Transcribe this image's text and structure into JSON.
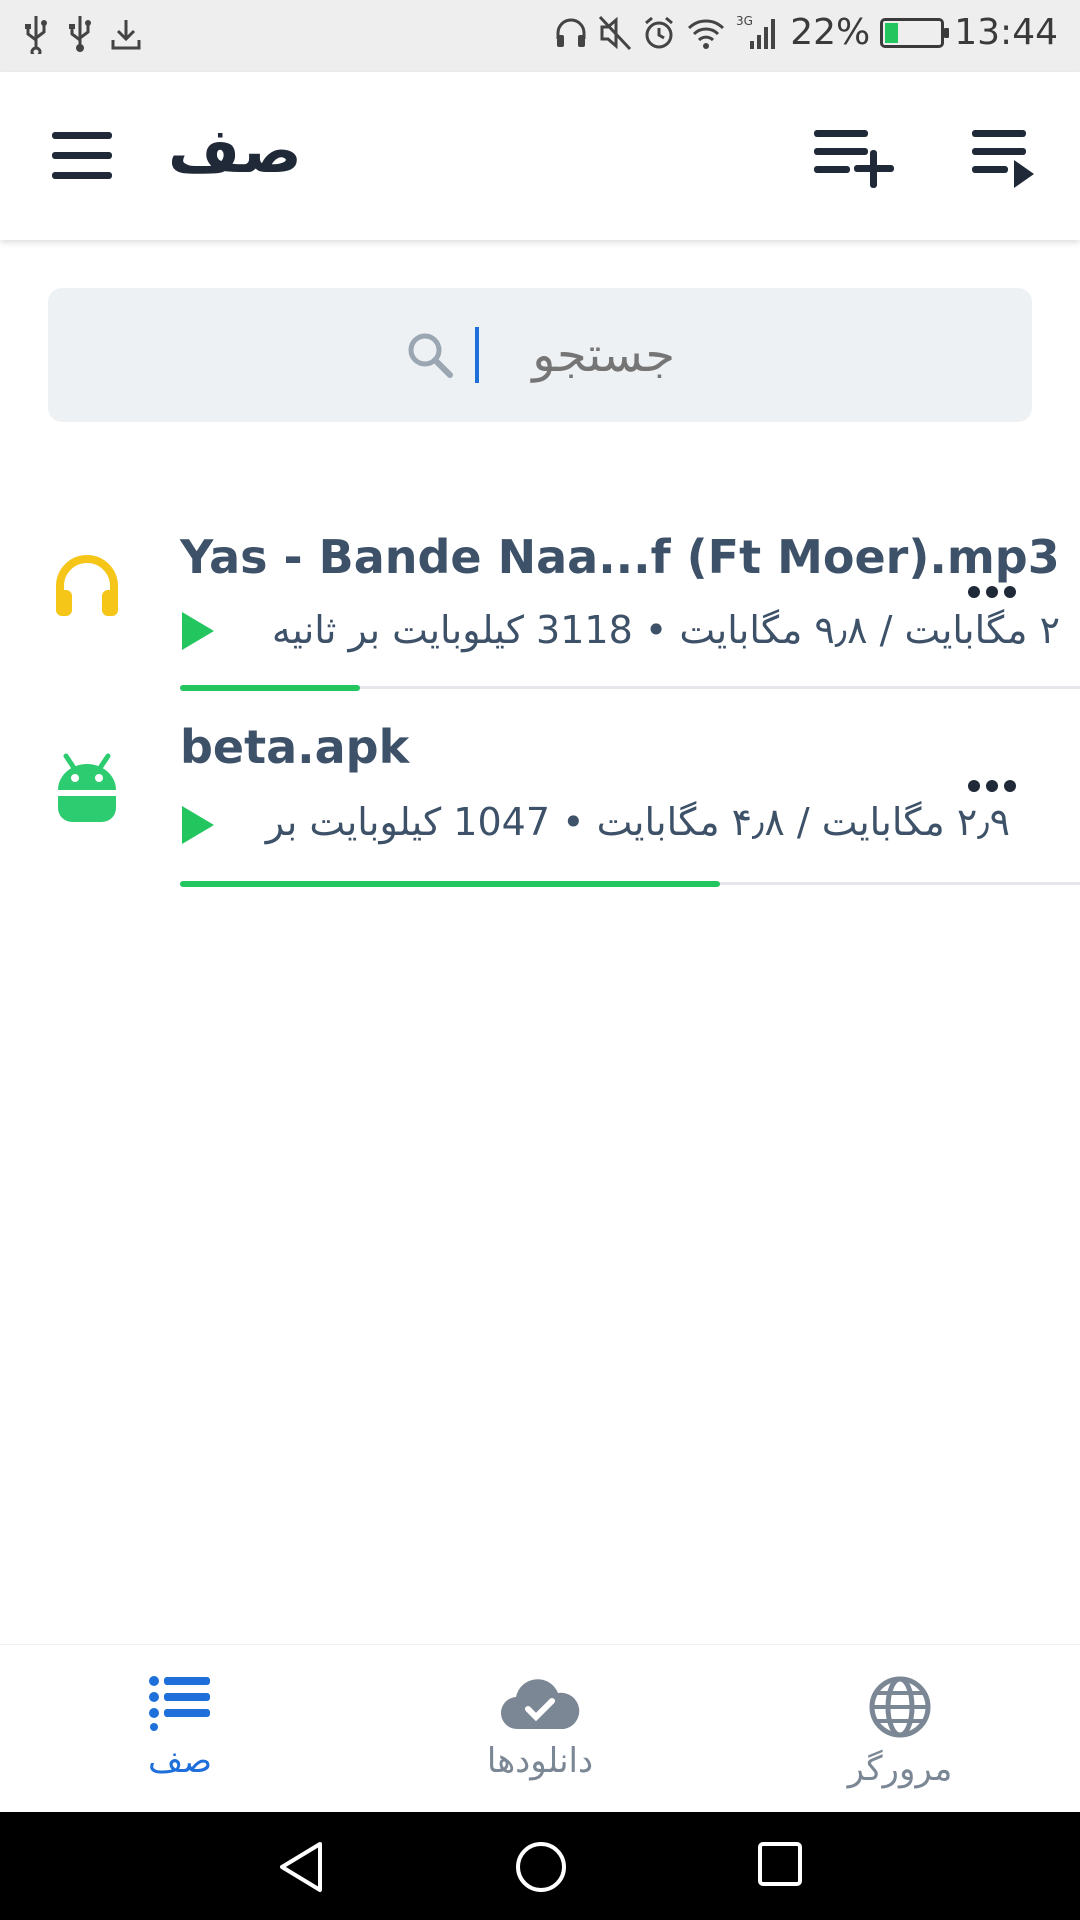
{
  "status_bar": {
    "battery_percent_text": "22%",
    "battery_level": 0.22,
    "time": "13:44",
    "network": "3G",
    "left_icons": [
      "usb-icon",
      "usb-icon",
      "download-icon"
    ],
    "right_icons": [
      "headset-icon",
      "mute-icon",
      "alarm-icon",
      "wifi-icon",
      "signal-icon"
    ]
  },
  "app_bar": {
    "title": "صف",
    "icons": [
      "menu-icon",
      "playlist-add-icon",
      "playlist-play-icon"
    ]
  },
  "search": {
    "placeholder": "جستجو"
  },
  "downloads": [
    {
      "name": "Yas - Bande Naa...f (Ft Moer).mp3",
      "icon": "headphones-icon",
      "icon_color": "#f5c518",
      "meta": "۲ مگابایت / ۹٫۸ مگابایت  •  3118 کیلوبایت بر ثانیه",
      "progress": 0.2
    },
    {
      "name": "beta.apk",
      "icon": "android-icon",
      "icon_color": "#2ecc71",
      "meta": "۲٫۹ مگابایت / ۴٫۸ مگابایت  •  1047 کیلوبایت بر",
      "progress": 0.6
    }
  ],
  "bottom_nav": {
    "items": [
      {
        "label": "صف",
        "icon": "list-icon",
        "active": true
      },
      {
        "label": "دانلودها",
        "icon": "cloud-check-icon",
        "active": false
      },
      {
        "label": "مرورگر",
        "icon": "globe-icon",
        "active": false
      }
    ]
  },
  "colors": {
    "accent": "#1e6fd9",
    "progress": "#22c55e",
    "text": "#3d5168"
  }
}
